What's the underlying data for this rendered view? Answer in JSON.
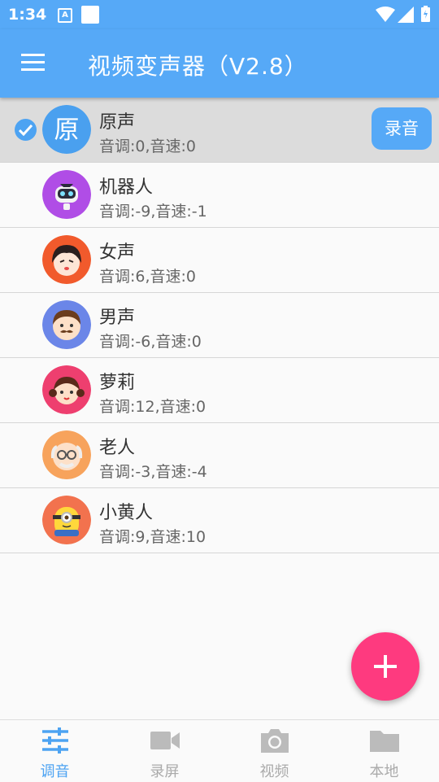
{
  "status_bar": {
    "time": "1:34",
    "notification_letter": "A"
  },
  "app_bar": {
    "title": "视频变声器（V2.8）"
  },
  "voices": [
    {
      "avatar_text": "原",
      "name": "原声",
      "params": "音调:0,音速:0",
      "selected": true,
      "record_label": "录音",
      "avatar_color": "#4aa0ef"
    },
    {
      "name": "机器人",
      "params": "音调:-9,音速:-1",
      "avatar_color": "#b04de6"
    },
    {
      "name": "女声",
      "params": "音调:6,音速:0",
      "avatar_color": "#f15a2c"
    },
    {
      "name": "男声",
      "params": "音调:-6,音速:0",
      "avatar_color": "#6b86e8"
    },
    {
      "name": "萝莉",
      "params": "音调:12,音速:0",
      "avatar_color": "#ee3f6f"
    },
    {
      "name": "老人",
      "params": "音调:-3,音速:-4",
      "avatar_color": "#f7a35c"
    },
    {
      "name": "小黄人",
      "params": "音调:9,音速:10",
      "avatar_color": "#f2724e"
    }
  ],
  "fab": {
    "icon": "plus-icon"
  },
  "bottom_nav": [
    {
      "label": "调音",
      "icon": "sliders-icon",
      "active": true
    },
    {
      "label": "录屏",
      "icon": "video-camera-icon",
      "active": false
    },
    {
      "label": "视频",
      "icon": "camera-icon",
      "active": false
    },
    {
      "label": "本地",
      "icon": "folder-icon",
      "active": false
    }
  ],
  "colors": {
    "primary": "#56a9f7",
    "accent": "#fe3a7f",
    "selected_row": "#dcdcdc"
  }
}
